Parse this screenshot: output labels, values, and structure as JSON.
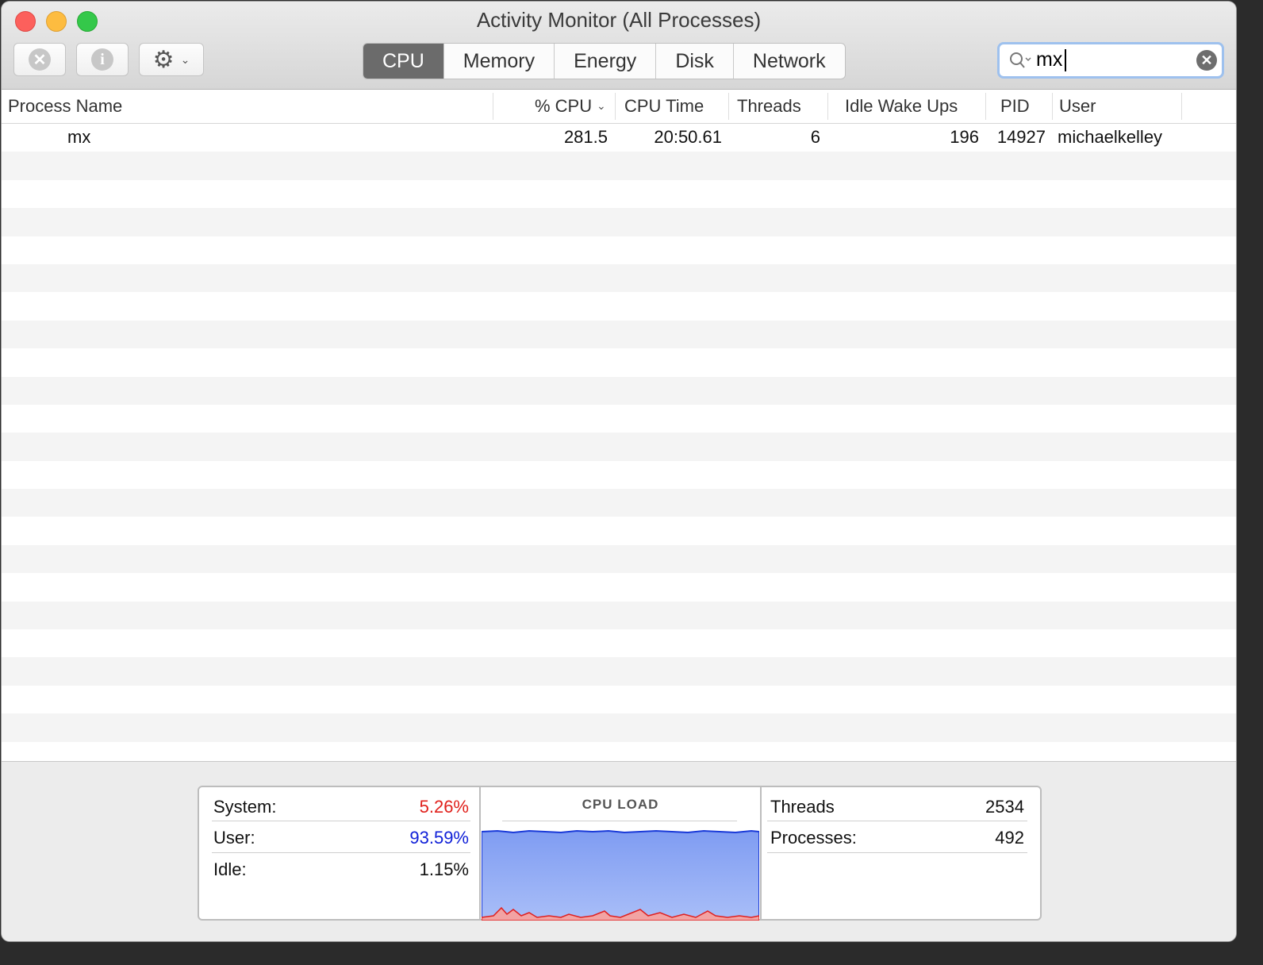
{
  "window": {
    "title": "Activity Monitor (All Processes)"
  },
  "toolbar": {
    "stop_icon": "close-x-icon",
    "info_icon": "info-icon",
    "gear_icon": "gear-icon",
    "tabs": [
      {
        "label": "CPU",
        "active": true
      },
      {
        "label": "Memory"
      },
      {
        "label": "Energy"
      },
      {
        "label": "Disk"
      },
      {
        "label": "Network"
      }
    ],
    "search": {
      "value": "mx"
    }
  },
  "table": {
    "columns": [
      "Process Name",
      "% CPU",
      "CPU Time",
      "Threads",
      "Idle Wake Ups",
      "PID",
      "User"
    ],
    "rows": [
      {
        "name": "mx",
        "cpu": "281.5",
        "cpu_time": "20:50.61",
        "threads": "6",
        "idle_wake_ups": "196",
        "pid": "14927",
        "user": "michaelkelley"
      }
    ]
  },
  "footer": {
    "system_label": "System:",
    "system_value": "5.26%",
    "user_label": "User:",
    "user_value": "93.59%",
    "idle_label": "Idle:",
    "idle_value": "1.15%",
    "cpu_load_title": "CPU LOAD",
    "threads_label": "Threads",
    "threads_value": "2534",
    "processes_label": "Processes:",
    "processes_value": "492",
    "colors": {
      "system": "#e0201b",
      "user": "#1020d8"
    }
  }
}
